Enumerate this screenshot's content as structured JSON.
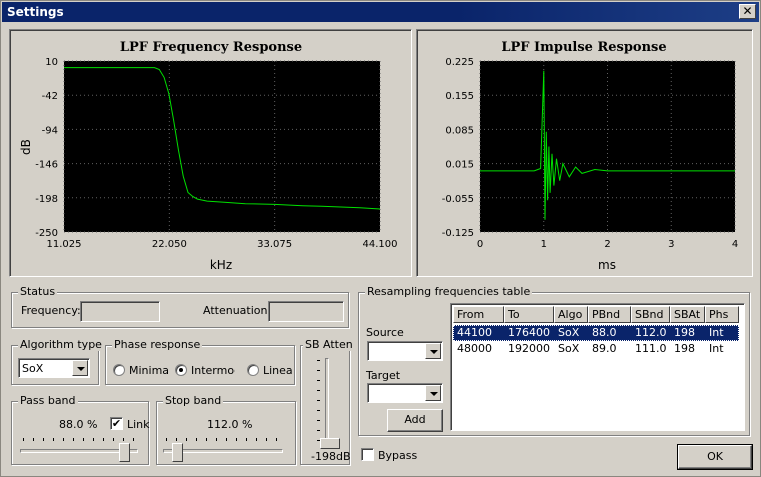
{
  "window": {
    "title": "Settings",
    "close_label": "✕"
  },
  "colors": {
    "plot_bg": "#000000",
    "plot_line": "#00e000",
    "grid": "#606060",
    "titlebar": "#0a246a",
    "selection": "#0a246a"
  },
  "charts": {
    "freq": {
      "title": "LPF Frequency Response",
      "xlabel": "kHz",
      "ylabel": "dB",
      "xticks": [
        "11.025",
        "22.050",
        "33.075",
        "44.100"
      ],
      "yticks": [
        "10",
        "-42",
        "-94",
        "-146",
        "-198",
        "-250"
      ]
    },
    "impulse": {
      "title": "LPF Impulse Response",
      "xlabel": "ms",
      "xticks": [
        "0",
        "1",
        "2",
        "3",
        "4"
      ],
      "yticks": [
        "0.225",
        "0.155",
        "0.085",
        "0.015",
        "-0.055",
        "-0.125"
      ]
    }
  },
  "chart_data": [
    {
      "type": "line",
      "title": "LPF Frequency Response",
      "xlabel": "kHz",
      "ylabel": "dB",
      "xlim": [
        11.025,
        44.1
      ],
      "ylim": [
        -250,
        10
      ],
      "grid": true,
      "series": [
        {
          "x": [
            11.025,
            20.5,
            21.0,
            21.5,
            22.0,
            22.5,
            23.0,
            23.5,
            24.0,
            24.5,
            25.0,
            26.0,
            28.0,
            30.0,
            33.075,
            36.0,
            38.0,
            40.0,
            42.0,
            44.1
          ],
          "values": [
            0,
            0,
            -3,
            -15,
            -40,
            -80,
            -125,
            -165,
            -190,
            -196,
            -200,
            -203,
            -205,
            -207,
            -208,
            -210,
            -211,
            -212,
            -213,
            -215
          ]
        }
      ]
    },
    {
      "type": "line",
      "title": "LPF Impulse Response",
      "xlabel": "ms",
      "xlim": [
        0,
        4
      ],
      "ylim": [
        -0.125,
        0.225
      ],
      "grid": true,
      "series": [
        {
          "x": [
            0,
            0.85,
            0.95,
            1.0,
            1.02,
            1.04,
            1.06,
            1.08,
            1.1,
            1.13,
            1.16,
            1.2,
            1.25,
            1.3,
            1.4,
            1.5,
            1.6,
            1.8,
            2.0,
            4.0
          ],
          "values": [
            0,
            0,
            0.005,
            0.205,
            -0.1,
            0.08,
            -0.06,
            0.05,
            -0.045,
            0.035,
            -0.03,
            0.025,
            -0.02,
            0.015,
            -0.012,
            0.008,
            -0.005,
            0.003,
            0,
            0
          ]
        }
      ]
    }
  ],
  "status": {
    "legend": "Status",
    "frequency_label": "Frequency:",
    "frequency_value": "",
    "attenuation_label": "Attenuation:",
    "attenuation_value": ""
  },
  "algorithm": {
    "legend": "Algorithm type",
    "value": "SoX"
  },
  "phase": {
    "legend": "Phase response",
    "options": [
      "Minima",
      "Intermoc",
      "Linear"
    ],
    "selected_index": 1
  },
  "sb_atten": {
    "legend": "SB Atten",
    "value": "-198dB",
    "level": 0.0
  },
  "passband": {
    "legend": "Pass band",
    "value": "88.0 %",
    "link_label": "Link",
    "link_checked": true,
    "level": 0.88
  },
  "stopband": {
    "legend": "Stop band",
    "value": "112.0 %",
    "level": 0.12
  },
  "resampling": {
    "legend": "Resampling frequencies table",
    "source_label": "Source",
    "source_value": "",
    "target_label": "Target",
    "target_value": "",
    "add_label": "Add",
    "columns": [
      "From",
      "To",
      "Algo",
      "PBnd",
      "SBnd",
      "SBAt",
      "Phs"
    ],
    "rows": [
      [
        "44100",
        "176400",
        "SoX",
        "88.0",
        "112.0",
        "198",
        "Int"
      ],
      [
        "48000",
        "192000",
        "SoX",
        "89.0",
        "111.0",
        "198",
        "Int"
      ]
    ],
    "selected_row": 0
  },
  "bypass": {
    "label": "Bypass",
    "checked": false
  },
  "ok_label": "OK"
}
